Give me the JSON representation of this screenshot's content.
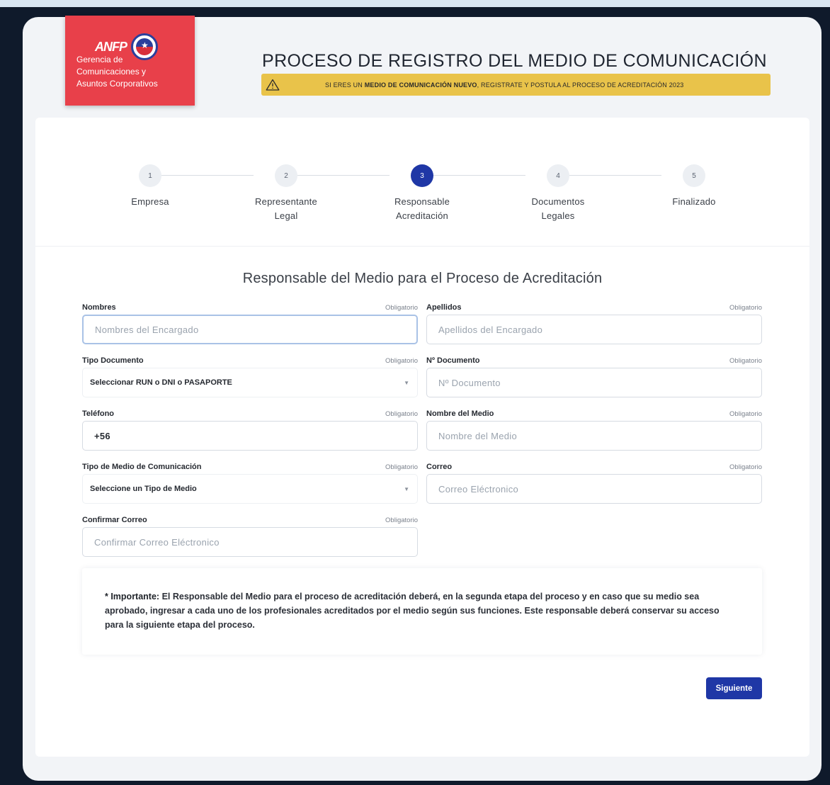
{
  "brand": {
    "logo_text": "ANFP",
    "lines": [
      "Gerencia de",
      "Comunicaciones y",
      "Asuntos Corporativos"
    ]
  },
  "header": {
    "title": "PROCESO DE REGISTRO DEL MEDIO DE COMUNICACIÓN",
    "notice": {
      "prefix": "SI ERES UN ",
      "emphasis": "MEDIO DE COMUNICACIÓN NUEVO",
      "suffix": ", REGISTRATE Y POSTULA AL PROCESO DE ACREDITACIÓN 2023"
    }
  },
  "stepper": {
    "active_step": 3,
    "steps": [
      {
        "number": "1",
        "line1": "Empresa",
        "line2": ""
      },
      {
        "number": "2",
        "line1": "Representante",
        "line2": "Legal"
      },
      {
        "number": "3",
        "line1": "Responsable",
        "line2": "Acreditación"
      },
      {
        "number": "4",
        "line1": "Documentos",
        "line2": "Legales"
      },
      {
        "number": "5",
        "line1": "Finalizado",
        "line2": ""
      }
    ]
  },
  "form": {
    "title": "Responsable del Medio para el Proceso de Acreditación",
    "required_label": "Obligatorio",
    "nombres": {
      "label": "Nombres",
      "placeholder": "Nombres del Encargado"
    },
    "apellidos": {
      "label": "Apellidos",
      "placeholder": "Apellidos del Encargado"
    },
    "tipo_documento": {
      "label": "Tipo Documento",
      "value": "Seleccionar RUN o DNI o PASAPORTE"
    },
    "n_documento": {
      "label": "Nº Documento",
      "placeholder": "Nº Documento"
    },
    "telefono": {
      "label": "Teléfono",
      "value": "+56"
    },
    "nombre_medio": {
      "label": "Nombre del Medio",
      "placeholder": "Nombre del Medio"
    },
    "tipo_medio": {
      "label": "Tipo de Medio de Comunicación",
      "value": "Seleccione un Tipo de Medio"
    },
    "correo": {
      "label": "Correo",
      "placeholder": "Correo Eléctronico"
    },
    "confirmar_correo": {
      "label": "Confirmar Correo",
      "placeholder": "Confirmar Correo Eléctronico"
    }
  },
  "important": {
    "label": "* Importante:",
    "text": " El Responsable del Medio para el proceso de acreditación deberá, en la segunda etapa del proceso y en caso que su medio sea aprobado, ingresar a cada uno de los profesionales acreditados por el medio según sus funciones. Este responsable deberá conservar su acceso para la siguiente etapa del proceso."
  },
  "actions": {
    "next_label": "Siguiente"
  },
  "colors": {
    "primary": "#1f37a6",
    "brand_red": "#e8404a",
    "notice_yellow": "#e9c34a"
  },
  "icons": {
    "warning": "warning-icon",
    "caret": "chevron-down-icon"
  }
}
